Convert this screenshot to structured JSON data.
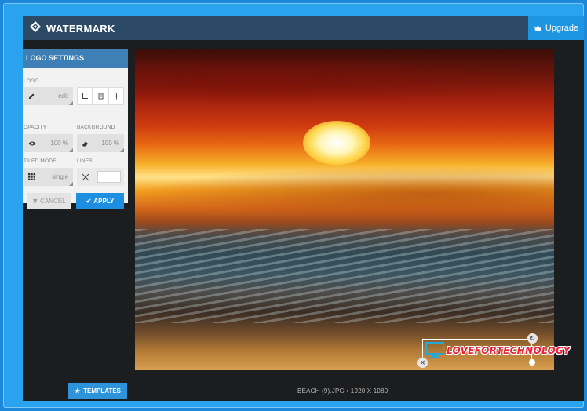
{
  "app": {
    "brand_name": "WATERMARK",
    "upgrade_label": "Upgrade"
  },
  "panel": {
    "title": "LOGO SETTINGS",
    "logo_label": "LOGO",
    "logo_value": "edit",
    "opacity_label": "OPACITY",
    "opacity_value": "100 %",
    "background_label": "BACKGROUND",
    "background_value": "100 %",
    "tiled_label": "TILED MODE",
    "tiled_value": "single",
    "lines_label": "LINES",
    "cancel_label": "CANCEL",
    "apply_label": "APPLY"
  },
  "image": {
    "watermark_text": "LOVEFORTECHNOLOGY",
    "file_info": "BEACH (9).JPG • 1920 X 1080"
  },
  "footer": {
    "templates_label": "TEMPLATES"
  },
  "colors": {
    "topbar": "#2c4a66",
    "accent": "#1e8fe0",
    "panel_header": "#3e7fb6",
    "watermark_text": "#e8223a"
  }
}
